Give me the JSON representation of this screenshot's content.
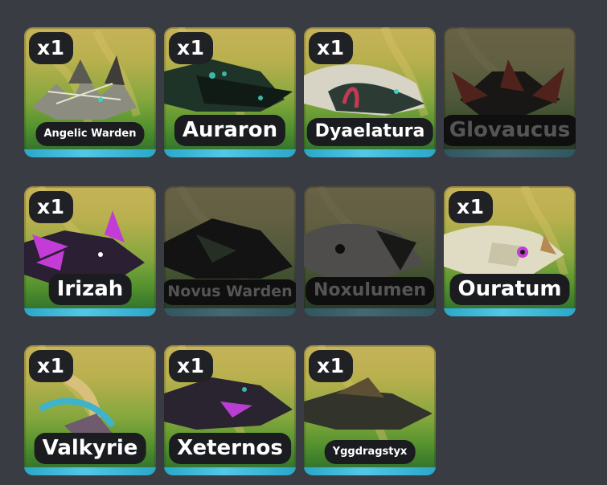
{
  "cards": [
    {
      "name": "Angelic Warden",
      "count": "x1",
      "owned": true,
      "accent": "#a8a8a0"
    },
    {
      "name": "Auraron",
      "count": "x1",
      "owned": true,
      "accent": "#1c3a2c"
    },
    {
      "name": "Dyaelatura",
      "count": "x1",
      "owned": true,
      "accent": "#d9d6c9"
    },
    {
      "name": "Glovaucus",
      "count": "",
      "owned": false,
      "accent": "#c4331b"
    },
    {
      "name": "Irizah",
      "count": "x1",
      "owned": true,
      "accent": "#c43cd6"
    },
    {
      "name": "Novus Warden",
      "count": "",
      "owned": false,
      "accent": "#2a2f28"
    },
    {
      "name": "Noxulumen",
      "count": "",
      "owned": false,
      "accent": "#6d6d66"
    },
    {
      "name": "Ouratum",
      "count": "x1",
      "owned": true,
      "accent": "#e0dcc4"
    },
    {
      "name": "Valkyrie",
      "count": "x1",
      "owned": true,
      "accent": "#3fb3c9"
    },
    {
      "name": "Xeternos",
      "count": "x1",
      "owned": true,
      "accent": "#2e2238"
    },
    {
      "name": "Yggdragstyx",
      "count": "x1",
      "owned": true,
      "accent": "#33352e"
    }
  ]
}
